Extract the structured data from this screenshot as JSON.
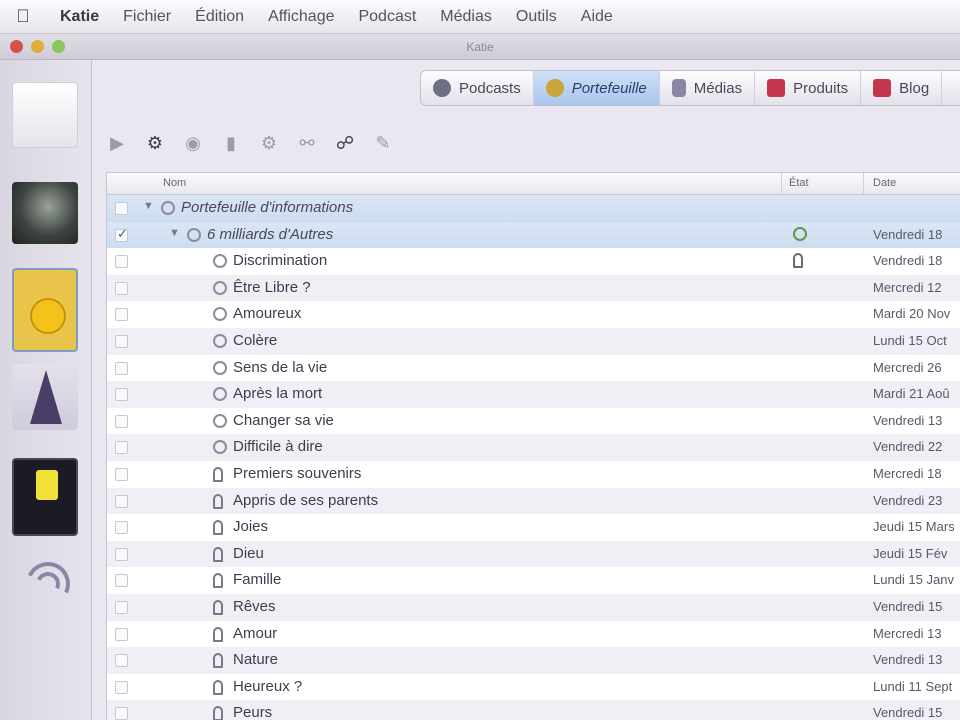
{
  "menubar": {
    "app": "Katie",
    "items": [
      "Fichier",
      "Édition",
      "Affichage",
      "Podcast",
      "Médias",
      "Outils",
      "Aide"
    ]
  },
  "window": {
    "title": "Katie"
  },
  "tabs": [
    {
      "label": "Podcasts",
      "icon": "podcast-icon",
      "active": false
    },
    {
      "label": "Portefeuille",
      "icon": "folder-icon",
      "active": true
    },
    {
      "label": "Médias",
      "icon": "media-icon",
      "active": false
    },
    {
      "label": "Produits",
      "icon": "product-icon",
      "active": false
    },
    {
      "label": "Blog",
      "icon": "blog-icon",
      "active": false
    }
  ],
  "table": {
    "columns": {
      "name": "Nom",
      "etat": "État",
      "date": "Date"
    },
    "rows": [
      {
        "label": "Portefeuille d'informations",
        "level": 0,
        "group": true,
        "checked": false,
        "icon": "folder",
        "state": "",
        "date": ""
      },
      {
        "label": "6 milliards d'Autres",
        "level": 1,
        "group": true,
        "checked": true,
        "icon": "folder",
        "state": "ok",
        "date": "Vendredi 18"
      },
      {
        "label": "Discrimination",
        "level": 2,
        "group": false,
        "checked": false,
        "icon": "circle",
        "state": "mic",
        "date": "Vendredi 18"
      },
      {
        "label": "Être Libre ?",
        "level": 2,
        "group": false,
        "checked": false,
        "icon": "circle",
        "state": "",
        "date": "Mercredi 12"
      },
      {
        "label": "Amoureux",
        "level": 2,
        "group": false,
        "checked": false,
        "icon": "circle",
        "state": "",
        "date": "Mardi 20 Nov"
      },
      {
        "label": "Colère",
        "level": 2,
        "group": false,
        "checked": false,
        "icon": "circle",
        "state": "",
        "date": "Lundi 15 Oct"
      },
      {
        "label": "Sens de la vie",
        "level": 2,
        "group": false,
        "checked": false,
        "icon": "circle",
        "state": "",
        "date": "Mercredi 26"
      },
      {
        "label": "Après la mort",
        "level": 2,
        "group": false,
        "checked": false,
        "icon": "circle",
        "state": "",
        "date": "Mardi 21 Aoû"
      },
      {
        "label": "Changer sa vie",
        "level": 2,
        "group": false,
        "checked": false,
        "icon": "circle",
        "state": "",
        "date": "Vendredi 13"
      },
      {
        "label": "Difficile à dire",
        "level": 2,
        "group": false,
        "checked": false,
        "icon": "circle",
        "state": "",
        "date": "Vendredi 22"
      },
      {
        "label": "Premiers souvenirs",
        "level": 2,
        "group": false,
        "checked": false,
        "icon": "mic",
        "state": "",
        "date": "Mercredi 18"
      },
      {
        "label": "Appris de ses parents",
        "level": 2,
        "group": false,
        "checked": false,
        "icon": "mic",
        "state": "",
        "date": "Vendredi 23"
      },
      {
        "label": "Joies",
        "level": 2,
        "group": false,
        "checked": false,
        "icon": "mic",
        "state": "",
        "date": "Jeudi 15 Mars"
      },
      {
        "label": "Dieu",
        "level": 2,
        "group": false,
        "checked": false,
        "icon": "mic",
        "state": "",
        "date": "Jeudi 15 Fév"
      },
      {
        "label": "Famille",
        "level": 2,
        "group": false,
        "checked": false,
        "icon": "mic",
        "state": "",
        "date": "Lundi 15 Janv"
      },
      {
        "label": "Rêves",
        "level": 2,
        "group": false,
        "checked": false,
        "icon": "mic",
        "state": "",
        "date": "Vendredi 15"
      },
      {
        "label": "Amour",
        "level": 2,
        "group": false,
        "checked": false,
        "icon": "mic",
        "state": "",
        "date": "Mercredi 13"
      },
      {
        "label": "Nature",
        "level": 2,
        "group": false,
        "checked": false,
        "icon": "mic",
        "state": "",
        "date": "Vendredi 13"
      },
      {
        "label": "Heureux ?",
        "level": 2,
        "group": false,
        "checked": false,
        "icon": "mic",
        "state": "",
        "date": "Lundi 11 Sept"
      },
      {
        "label": "Peurs",
        "level": 2,
        "group": false,
        "checked": false,
        "icon": "mic",
        "state": "",
        "date": "Vendredi 15"
      }
    ]
  }
}
